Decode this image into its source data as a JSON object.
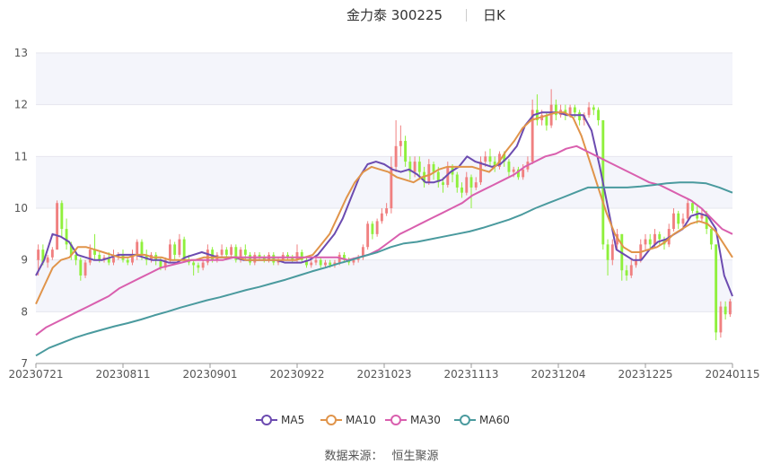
{
  "header": {
    "stock_name": "金力泰 300225",
    "period": "日K"
  },
  "source": {
    "label": "数据来源：",
    "value": "恒生聚源"
  },
  "colors": {
    "up": "#f08080",
    "down": "#8ff03c",
    "ma5": "#6c4bb0",
    "ma10": "#e0944a",
    "ma30": "#d95fae",
    "ma60": "#4a9a9e"
  },
  "chart_data": {
    "type": "candlestick",
    "ylim": [
      7,
      13
    ],
    "yticks": [
      7,
      8,
      9,
      10,
      11,
      12,
      13
    ],
    "x_tick_labels": [
      "20230721",
      "20230811",
      "20230901",
      "20230922",
      "20231023",
      "20231113",
      "20231204",
      "20231225",
      "20240115"
    ],
    "grid": true,
    "legend_position": "bottom",
    "legend": [
      "MA5",
      "MA10",
      "MA30",
      "MA60"
    ],
    "candles": [
      {
        "o": 9.0,
        "c": 9.2,
        "h": 9.3,
        "l": 8.7
      },
      {
        "o": 9.2,
        "c": 8.95,
        "h": 9.3,
        "l": 8.9
      },
      {
        "o": 8.95,
        "c": 9.05,
        "h": 9.1,
        "l": 8.85
      },
      {
        "o": 9.05,
        "c": 9.2,
        "h": 9.25,
        "l": 9.0
      },
      {
        "o": 9.2,
        "c": 10.1,
        "h": 10.15,
        "l": 9.2
      },
      {
        "o": 10.1,
        "c": 9.6,
        "h": 10.15,
        "l": 9.45
      },
      {
        "o": 9.6,
        "c": 9.3,
        "h": 9.8,
        "l": 9.2
      },
      {
        "o": 9.3,
        "c": 9.1,
        "h": 9.35,
        "l": 9.0
      },
      {
        "o": 9.1,
        "c": 9.0,
        "h": 9.2,
        "l": 8.9
      },
      {
        "o": 9.0,
        "c": 8.7,
        "h": 9.05,
        "l": 8.6
      },
      {
        "o": 8.7,
        "c": 8.95,
        "h": 9.0,
        "l": 8.65
      },
      {
        "o": 8.95,
        "c": 9.2,
        "h": 9.3,
        "l": 8.9
      },
      {
        "o": 9.2,
        "c": 9.1,
        "h": 9.5,
        "l": 9.0
      },
      {
        "o": 9.1,
        "c": 9.0,
        "h": 9.15,
        "l": 8.95
      },
      {
        "o": 9.0,
        "c": 9.05,
        "h": 9.1,
        "l": 8.95
      },
      {
        "o": 9.05,
        "c": 8.95,
        "h": 9.15,
        "l": 8.9
      },
      {
        "o": 8.95,
        "c": 9.05,
        "h": 9.2,
        "l": 8.9
      },
      {
        "o": 9.05,
        "c": 9.1,
        "h": 9.15,
        "l": 9.0
      },
      {
        "o": 9.1,
        "c": 9.0,
        "h": 9.2,
        "l": 8.95
      },
      {
        "o": 9.0,
        "c": 8.95,
        "h": 9.05,
        "l": 8.9
      },
      {
        "o": 8.95,
        "c": 9.1,
        "h": 9.2,
        "l": 8.9
      },
      {
        "o": 9.1,
        "c": 9.35,
        "h": 9.4,
        "l": 9.0
      },
      {
        "o": 9.35,
        "c": 9.1,
        "h": 9.4,
        "l": 9.0
      },
      {
        "o": 9.1,
        "c": 9.0,
        "h": 9.2,
        "l": 8.9
      },
      {
        "o": 9.0,
        "c": 9.1,
        "h": 9.15,
        "l": 8.95
      },
      {
        "o": 9.1,
        "c": 9.0,
        "h": 9.15,
        "l": 8.9
      },
      {
        "o": 9.0,
        "c": 8.85,
        "h": 9.05,
        "l": 8.8
      },
      {
        "o": 8.85,
        "c": 9.0,
        "h": 9.05,
        "l": 8.8
      },
      {
        "o": 9.0,
        "c": 9.3,
        "h": 9.4,
        "l": 8.95
      },
      {
        "o": 9.3,
        "c": 9.1,
        "h": 9.35,
        "l": 9.0
      },
      {
        "o": 9.1,
        "c": 9.4,
        "h": 9.5,
        "l": 9.05
      },
      {
        "o": 9.4,
        "c": 9.0,
        "h": 9.45,
        "l": 8.95
      },
      {
        "o": 9.0,
        "c": 8.95,
        "h": 9.1,
        "l": 8.9
      },
      {
        "o": 8.95,
        "c": 8.9,
        "h": 9.0,
        "l": 8.7
      },
      {
        "o": 8.9,
        "c": 8.85,
        "h": 8.95,
        "l": 8.75
      },
      {
        "o": 8.85,
        "c": 8.95,
        "h": 9.0,
        "l": 8.8
      },
      {
        "o": 8.95,
        "c": 9.2,
        "h": 9.3,
        "l": 8.9
      },
      {
        "o": 9.2,
        "c": 9.0,
        "h": 9.25,
        "l": 8.95
      },
      {
        "o": 9.0,
        "c": 9.1,
        "h": 9.15,
        "l": 8.95
      },
      {
        "o": 9.1,
        "c": 9.2,
        "h": 9.3,
        "l": 9.05
      },
      {
        "o": 9.2,
        "c": 9.1,
        "h": 9.25,
        "l": 9.0
      },
      {
        "o": 9.1,
        "c": 9.25,
        "h": 9.3,
        "l": 9.05
      },
      {
        "o": 9.25,
        "c": 9.0,
        "h": 9.3,
        "l": 8.95
      },
      {
        "o": 9.0,
        "c": 9.2,
        "h": 9.25,
        "l": 8.95
      },
      {
        "o": 9.2,
        "c": 9.1,
        "h": 9.3,
        "l": 9.0
      },
      {
        "o": 9.1,
        "c": 8.95,
        "h": 9.15,
        "l": 8.9
      },
      {
        "o": 8.95,
        "c": 9.1,
        "h": 9.15,
        "l": 8.9
      },
      {
        "o": 9.1,
        "c": 9.05,
        "h": 9.15,
        "l": 9.0
      },
      {
        "o": 9.05,
        "c": 9.0,
        "h": 9.1,
        "l": 8.95
      },
      {
        "o": 9.0,
        "c": 9.1,
        "h": 9.15,
        "l": 8.95
      },
      {
        "o": 9.1,
        "c": 8.95,
        "h": 9.15,
        "l": 8.9
      },
      {
        "o": 8.95,
        "c": 9.0,
        "h": 9.05,
        "l": 8.9
      },
      {
        "o": 9.0,
        "c": 9.1,
        "h": 9.15,
        "l": 8.95
      },
      {
        "o": 9.1,
        "c": 9.05,
        "h": 9.15,
        "l": 9.0
      },
      {
        "o": 9.05,
        "c": 9.0,
        "h": 9.1,
        "l": 8.95
      },
      {
        "o": 9.0,
        "c": 9.15,
        "h": 9.3,
        "l": 8.95
      },
      {
        "o": 9.15,
        "c": 9.0,
        "h": 9.2,
        "l": 8.95
      },
      {
        "o": 9.0,
        "c": 8.9,
        "h": 9.05,
        "l": 8.85
      },
      {
        "o": 8.9,
        "c": 8.95,
        "h": 9.0,
        "l": 8.85
      },
      {
        "o": 8.95,
        "c": 9.0,
        "h": 9.05,
        "l": 8.9
      },
      {
        "o": 9.0,
        "c": 8.9,
        "h": 9.05,
        "l": 8.85
      },
      {
        "o": 8.9,
        "c": 8.95,
        "h": 9.0,
        "l": 8.85
      },
      {
        "o": 8.95,
        "c": 8.9,
        "h": 9.0,
        "l": 8.85
      },
      {
        "o": 8.9,
        "c": 8.95,
        "h": 9.0,
        "l": 8.85
      },
      {
        "o": 8.95,
        "c": 9.1,
        "h": 9.15,
        "l": 8.9
      },
      {
        "o": 9.1,
        "c": 9.0,
        "h": 9.15,
        "l": 8.95
      },
      {
        "o": 9.0,
        "c": 8.95,
        "h": 9.05,
        "l": 8.9
      },
      {
        "o": 8.95,
        "c": 9.0,
        "h": 9.05,
        "l": 8.9
      },
      {
        "o": 9.0,
        "c": 9.05,
        "h": 9.1,
        "l": 8.95
      },
      {
        "o": 9.05,
        "c": 9.25,
        "h": 9.3,
        "l": 9.0
      },
      {
        "o": 9.25,
        "c": 9.7,
        "h": 9.75,
        "l": 9.2
      },
      {
        "o": 9.7,
        "c": 9.5,
        "h": 9.75,
        "l": 9.4
      },
      {
        "o": 9.5,
        "c": 9.75,
        "h": 9.8,
        "l": 9.45
      },
      {
        "o": 9.75,
        "c": 9.9,
        "h": 10.0,
        "l": 9.7
      },
      {
        "o": 9.9,
        "c": 10.0,
        "h": 10.1,
        "l": 9.85
      },
      {
        "o": 10.0,
        "c": 10.8,
        "h": 11.0,
        "l": 9.9
      },
      {
        "o": 10.8,
        "c": 11.2,
        "h": 11.7,
        "l": 10.7
      },
      {
        "o": 11.2,
        "c": 11.3,
        "h": 11.6,
        "l": 11.0
      },
      {
        "o": 11.3,
        "c": 10.9,
        "h": 11.4,
        "l": 10.8
      },
      {
        "o": 10.9,
        "c": 10.7,
        "h": 11.0,
        "l": 10.55
      },
      {
        "o": 10.7,
        "c": 10.9,
        "h": 11.0,
        "l": 10.6
      },
      {
        "o": 10.9,
        "c": 10.7,
        "h": 11.0,
        "l": 10.55
      },
      {
        "o": 10.7,
        "c": 10.5,
        "h": 10.8,
        "l": 10.4
      },
      {
        "o": 10.5,
        "c": 10.85,
        "h": 10.95,
        "l": 10.45
      },
      {
        "o": 10.85,
        "c": 10.7,
        "h": 10.9,
        "l": 10.55
      },
      {
        "o": 10.7,
        "c": 10.5,
        "h": 10.8,
        "l": 10.4
      },
      {
        "o": 10.5,
        "c": 10.45,
        "h": 10.6,
        "l": 10.3
      },
      {
        "o": 10.45,
        "c": 10.8,
        "h": 10.9,
        "l": 10.4
      },
      {
        "o": 10.8,
        "c": 10.65,
        "h": 10.85,
        "l": 10.5
      },
      {
        "o": 10.65,
        "c": 10.4,
        "h": 10.7,
        "l": 10.3
      },
      {
        "o": 10.4,
        "c": 10.3,
        "h": 10.5,
        "l": 10.2
      },
      {
        "o": 10.3,
        "c": 10.6,
        "h": 10.7,
        "l": 10.25
      },
      {
        "o": 10.6,
        "c": 10.4,
        "h": 10.65,
        "l": 10.0
      },
      {
        "o": 10.4,
        "c": 10.5,
        "h": 10.6,
        "l": 10.35
      },
      {
        "o": 10.5,
        "c": 10.9,
        "h": 11.0,
        "l": 10.45
      },
      {
        "o": 10.9,
        "c": 11.0,
        "h": 11.1,
        "l": 10.8
      },
      {
        "o": 11.0,
        "c": 10.9,
        "h": 11.15,
        "l": 10.8
      },
      {
        "o": 10.9,
        "c": 10.8,
        "h": 11.0,
        "l": 10.7
      },
      {
        "o": 10.8,
        "c": 11.05,
        "h": 11.1,
        "l": 10.75
      },
      {
        "o": 11.05,
        "c": 10.9,
        "h": 11.1,
        "l": 10.8
      },
      {
        "o": 10.9,
        "c": 10.7,
        "h": 10.95,
        "l": 10.6
      },
      {
        "o": 10.7,
        "c": 10.75,
        "h": 10.8,
        "l": 10.6
      },
      {
        "o": 10.75,
        "c": 10.6,
        "h": 10.8,
        "l": 10.55
      },
      {
        "o": 10.6,
        "c": 10.75,
        "h": 10.85,
        "l": 10.55
      },
      {
        "o": 10.75,
        "c": 10.9,
        "h": 11.0,
        "l": 10.7
      },
      {
        "o": 10.9,
        "c": 11.9,
        "h": 12.1,
        "l": 10.85
      },
      {
        "o": 11.9,
        "c": 11.7,
        "h": 12.2,
        "l": 11.6
      },
      {
        "o": 11.7,
        "c": 11.8,
        "h": 11.9,
        "l": 11.6
      },
      {
        "o": 11.8,
        "c": 11.6,
        "h": 11.85,
        "l": 11.5
      },
      {
        "o": 11.6,
        "c": 12.0,
        "h": 12.3,
        "l": 11.55
      },
      {
        "o": 12.0,
        "c": 11.8,
        "h": 12.1,
        "l": 11.7
      },
      {
        "o": 11.8,
        "c": 11.9,
        "h": 12.0,
        "l": 11.75
      },
      {
        "o": 11.9,
        "c": 11.8,
        "h": 12.0,
        "l": 11.7
      },
      {
        "o": 11.8,
        "c": 11.95,
        "h": 12.0,
        "l": 11.75
      },
      {
        "o": 11.95,
        "c": 11.85,
        "h": 12.0,
        "l": 11.75
      },
      {
        "o": 11.85,
        "c": 11.7,
        "h": 11.9,
        "l": 11.6
      },
      {
        "o": 11.7,
        "c": 11.8,
        "h": 11.85,
        "l": 11.6
      },
      {
        "o": 11.8,
        "c": 11.95,
        "h": 12.05,
        "l": 11.75
      },
      {
        "o": 11.95,
        "c": 11.9,
        "h": 12.0,
        "l": 11.8
      },
      {
        "o": 11.9,
        "c": 11.7,
        "h": 11.95,
        "l": 11.6
      },
      {
        "o": 11.7,
        "c": 9.3,
        "h": 11.7,
        "l": 9.2
      },
      {
        "o": 9.3,
        "c": 9.0,
        "h": 9.4,
        "l": 8.7
      },
      {
        "o": 9.0,
        "c": 9.3,
        "h": 9.4,
        "l": 8.9
      },
      {
        "o": 9.3,
        "c": 9.5,
        "h": 9.6,
        "l": 9.2
      },
      {
        "o": 9.5,
        "c": 8.8,
        "h": 9.5,
        "l": 8.6
      },
      {
        "o": 8.8,
        "c": 8.7,
        "h": 8.9,
        "l": 8.6
      },
      {
        "o": 8.7,
        "c": 8.9,
        "h": 9.0,
        "l": 8.65
      },
      {
        "o": 8.9,
        "c": 9.0,
        "h": 9.1,
        "l": 8.85
      },
      {
        "o": 9.0,
        "c": 9.3,
        "h": 9.4,
        "l": 8.95
      },
      {
        "o": 9.3,
        "c": 9.4,
        "h": 9.5,
        "l": 9.2
      },
      {
        "o": 9.4,
        "c": 9.3,
        "h": 9.5,
        "l": 9.2
      },
      {
        "o": 9.3,
        "c": 9.5,
        "h": 9.6,
        "l": 9.25
      },
      {
        "o": 9.5,
        "c": 9.4,
        "h": 9.55,
        "l": 9.3
      },
      {
        "o": 9.4,
        "c": 9.3,
        "h": 9.45,
        "l": 9.2
      },
      {
        "o": 9.3,
        "c": 9.6,
        "h": 9.7,
        "l": 9.25
      },
      {
        "o": 9.6,
        "c": 9.9,
        "h": 10.0,
        "l": 9.55
      },
      {
        "o": 9.9,
        "c": 9.7,
        "h": 9.95,
        "l": 9.6
      },
      {
        "o": 9.7,
        "c": 9.8,
        "h": 9.9,
        "l": 9.6
      },
      {
        "o": 9.8,
        "c": 10.1,
        "h": 10.2,
        "l": 9.75
      },
      {
        "o": 10.1,
        "c": 9.95,
        "h": 10.15,
        "l": 9.9
      },
      {
        "o": 9.95,
        "c": 9.8,
        "h": 10.05,
        "l": 9.7
      },
      {
        "o": 9.8,
        "c": 9.9,
        "h": 10.0,
        "l": 9.75
      },
      {
        "o": 9.9,
        "c": 9.6,
        "h": 9.95,
        "l": 9.5
      },
      {
        "o": 9.6,
        "c": 9.3,
        "h": 9.65,
        "l": 9.2
      },
      {
        "o": 9.3,
        "c": 7.6,
        "h": 9.3,
        "l": 7.45
      },
      {
        "o": 7.6,
        "c": 8.1,
        "h": 8.2,
        "l": 7.5
      },
      {
        "o": 8.1,
        "c": 7.95,
        "h": 8.2,
        "l": 7.85
      },
      {
        "o": 7.95,
        "c": 8.2,
        "h": 8.25,
        "l": 7.9
      }
    ],
    "series": [
      {
        "name": "MA5",
        "values": [
          8.7,
          9.0,
          9.5,
          9.45,
          9.35,
          9.1,
          9.05,
          9.0,
          9.0,
          9.05,
          9.1,
          9.1,
          9.1,
          9.05,
          9.0,
          9.0,
          8.95,
          8.95,
          9.05,
          9.1,
          9.15,
          9.1,
          9.05,
          9.05,
          9.05,
          9.0,
          9.0,
          9.0,
          9.0,
          9.0,
          8.95,
          8.95,
          8.95,
          9.0,
          9.1,
          9.3,
          9.5,
          9.8,
          10.2,
          10.6,
          10.85,
          10.9,
          10.85,
          10.75,
          10.7,
          10.75,
          10.65,
          10.5,
          10.5,
          10.55,
          10.7,
          10.8,
          11.0,
          10.9,
          10.85,
          10.8,
          10.85,
          11.0,
          11.2,
          11.6,
          11.8,
          11.85,
          11.85,
          11.85,
          11.8,
          11.8,
          11.8,
          11.5,
          10.8,
          10.0,
          9.2,
          9.1,
          9.0,
          9.0,
          9.2,
          9.35,
          9.4,
          9.5,
          9.6,
          9.85,
          9.9,
          9.85,
          9.6,
          8.7,
          8.3
        ]
      },
      {
        "name": "MA10",
        "values": [
          8.15,
          8.5,
          8.85,
          9.0,
          9.05,
          9.25,
          9.25,
          9.2,
          9.15,
          9.1,
          9.05,
          9.05,
          9.1,
          9.1,
          9.05,
          9.05,
          9.0,
          9.0,
          9.0,
          9.0,
          9.05,
          9.05,
          9.05,
          9.05,
          9.05,
          9.0,
          9.0,
          9.0,
          9.0,
          9.0,
          9.0,
          9.0,
          9.05,
          9.1,
          9.3,
          9.5,
          9.85,
          10.2,
          10.5,
          10.7,
          10.8,
          10.75,
          10.7,
          10.6,
          10.55,
          10.5,
          10.6,
          10.65,
          10.75,
          10.8,
          10.8,
          10.8,
          10.8,
          10.75,
          10.7,
          10.85,
          11.1,
          11.3,
          11.55,
          11.7,
          11.75,
          11.8,
          11.85,
          11.85,
          11.75,
          11.4,
          10.9,
          10.4,
          9.9,
          9.5,
          9.25,
          9.15,
          9.15,
          9.2,
          9.25,
          9.35,
          9.5,
          9.6,
          9.7,
          9.75,
          9.7,
          9.55,
          9.3,
          9.05
        ]
      },
      {
        "name": "MA30",
        "values": [
          7.55,
          7.7,
          7.8,
          7.9,
          8.0,
          8.1,
          8.2,
          8.3,
          8.45,
          8.55,
          8.65,
          8.75,
          8.85,
          8.9,
          8.95,
          9.0,
          9.0,
          9.0,
          9.0,
          9.05,
          9.05,
          9.05,
          9.05,
          9.05,
          9.05,
          9.05,
          9.05,
          9.05,
          9.05,
          9.05,
          9.0,
          9.05,
          9.1,
          9.2,
          9.35,
          9.5,
          9.6,
          9.7,
          9.8,
          9.9,
          10.0,
          10.1,
          10.25,
          10.35,
          10.45,
          10.55,
          10.65,
          10.8,
          10.9,
          11.0,
          11.05,
          11.15,
          11.2,
          11.1,
          11.0,
          10.9,
          10.8,
          10.7,
          10.6,
          10.5,
          10.45,
          10.35,
          10.25,
          10.15,
          10.0,
          9.8,
          9.6,
          9.5
        ]
      },
      {
        "name": "MA60",
        "values": [
          7.15,
          7.3,
          7.4,
          7.5,
          7.58,
          7.65,
          7.72,
          7.78,
          7.85,
          7.93,
          8.0,
          8.08,
          8.15,
          8.22,
          8.28,
          8.35,
          8.42,
          8.48,
          8.55,
          8.62,
          8.7,
          8.78,
          8.85,
          8.93,
          9.0,
          9.08,
          9.15,
          9.25,
          9.32,
          9.35,
          9.4,
          9.45,
          9.5,
          9.55,
          9.62,
          9.7,
          9.78,
          9.88,
          10.0,
          10.1,
          10.2,
          10.3,
          10.4,
          10.4,
          10.4,
          10.4,
          10.42,
          10.45,
          10.48,
          10.5,
          10.5,
          10.48,
          10.4,
          10.3
        ]
      }
    ]
  }
}
